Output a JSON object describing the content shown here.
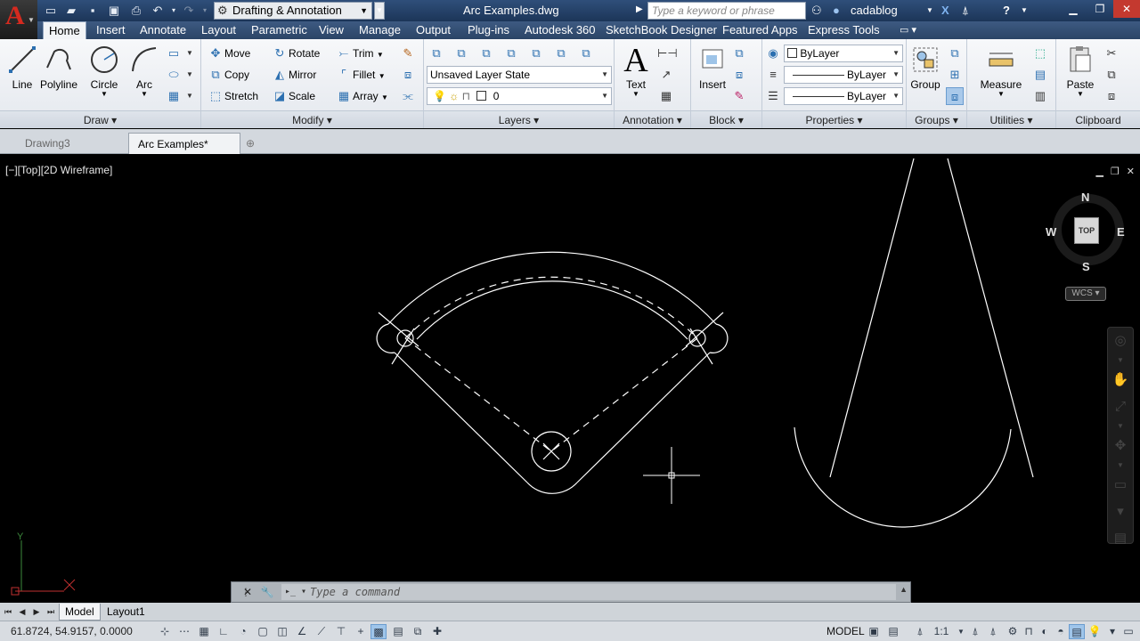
{
  "titlebar": {
    "workspace": "Drafting & Annotation",
    "document_title": "Arc Examples.dwg",
    "search_placeholder": "Type a keyword or phrase",
    "user": "cadablog"
  },
  "ribbon_tabs": [
    "Home",
    "Insert",
    "Annotate",
    "Layout",
    "Parametric",
    "View",
    "Manage",
    "Output",
    "Plug-ins",
    "Autodesk 360",
    "SketchBook Designer",
    "Featured Apps",
    "Express Tools"
  ],
  "draw": {
    "title": "Draw",
    "line": "Line",
    "polyline": "Polyline",
    "circle": "Circle",
    "arc": "Arc"
  },
  "modify": {
    "title": "Modify",
    "move": "Move",
    "rotate": "Rotate",
    "trim": "Trim",
    "copy": "Copy",
    "mirror": "Mirror",
    "fillet": "Fillet",
    "stretch": "Stretch",
    "scale": "Scale",
    "array": "Array"
  },
  "layers": {
    "title": "Layers",
    "layer_state": "Unsaved Layer State",
    "current_layer": "0"
  },
  "annotation": {
    "title": "Annotation",
    "text": "Text"
  },
  "block": {
    "title": "Block",
    "insert": "Insert"
  },
  "properties": {
    "title": "Properties",
    "color": "ByLayer",
    "linetype": "ByLayer",
    "lineweight": "ByLayer"
  },
  "groups": {
    "title": "Groups",
    "group": "Group"
  },
  "utilities": {
    "title": "Utilities",
    "measure": "Measure"
  },
  "clipboard": {
    "title": "Clipboard",
    "paste": "Paste"
  },
  "file_tabs": [
    {
      "label": "Drawing3"
    },
    {
      "label": "Arc Examples*"
    }
  ],
  "viewport": {
    "label": "[−][Top][2D Wireframe]",
    "viewcube_face": "TOP",
    "compass": {
      "n": "N",
      "s": "S",
      "e": "E",
      "w": "W"
    },
    "wcs": "WCS",
    "ucs_y": "Y"
  },
  "command": {
    "placeholder": "Type a command"
  },
  "layout_tabs": {
    "model": "Model",
    "layout1": "Layout1"
  },
  "status": {
    "coords": "61.8724, 54.9157, 0.0000",
    "model": "MODEL",
    "scale": "1:1"
  },
  "colors": {
    "title_bg": "#1c3558",
    "ribbon_bg": "#eef1f5",
    "canvas": "#000000",
    "geometry": "#ffffff",
    "accent_red": "#d62a1f"
  }
}
